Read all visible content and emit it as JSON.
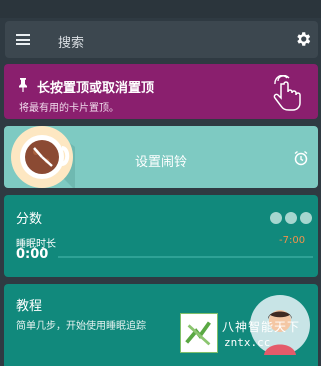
{
  "search": {
    "placeholder_text": "搜索"
  },
  "pin_card": {
    "title": "长按置顶或取消置顶",
    "subtitle": "将最有用的卡片置顶。",
    "color": "#8a1f6e"
  },
  "alarm_card": {
    "label": "设置闹铃",
    "color": "#7ecac2"
  },
  "score_card": {
    "title": "分数",
    "sleep_label": "睡眠时长",
    "sleep_value": "0:00",
    "delta": "-7:00",
    "color": "#11897c"
  },
  "tutorial_card": {
    "title": "教程",
    "subtitle": "简单几步，开始使用睡眠追踪"
  },
  "watermark": {
    "brand": "八神智能天下",
    "domain": "zntx.cc"
  },
  "icons": {
    "menu": "hamburger-menu-icon",
    "settings": "gear-icon",
    "pin": "pin-icon",
    "tap": "hand-tap-icon",
    "alarm": "alarm-clock-icon"
  }
}
